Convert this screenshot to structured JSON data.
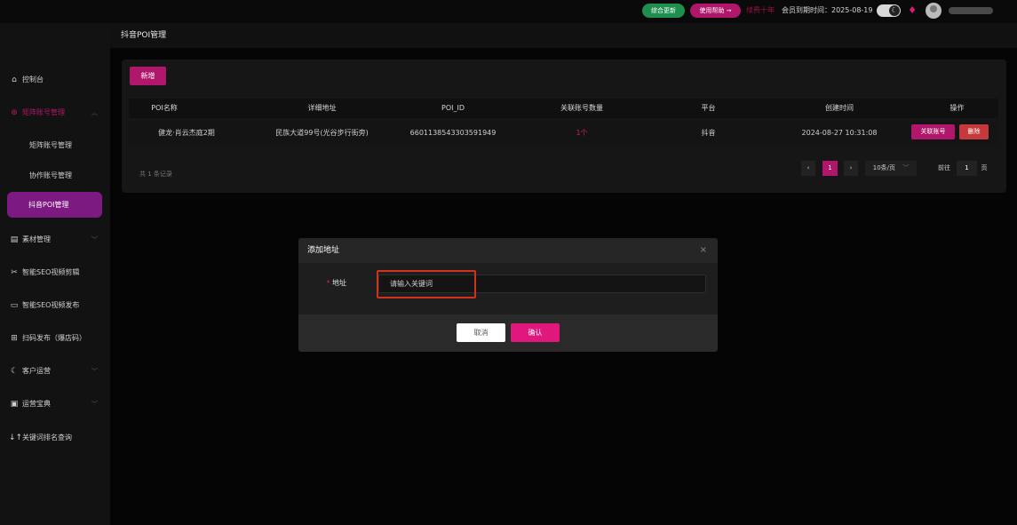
{
  "header": {
    "update_label": "综合更新",
    "help_label": "使用帮助 →",
    "renew_label": "续费十年",
    "expire_text": "会员到期时间：2025-08-19",
    "toggle_icon": "moon-icon",
    "bell_icon": "bell-icon"
  },
  "sidebar": {
    "items": [
      {
        "label": "控制台",
        "icon": "⌂"
      },
      {
        "label": "矩阵账号管理",
        "icon": "⊕"
      },
      {
        "label": "矩阵账号管理",
        "sub": true
      },
      {
        "label": "协作账号管理",
        "sub": true
      },
      {
        "label": "抖音POI管理",
        "sub": true
      },
      {
        "label": "素材管理",
        "icon": "▤"
      },
      {
        "label": "智能SEO视频剪辑",
        "icon": "✂"
      },
      {
        "label": "智能SEO视频发布",
        "icon": "▭"
      },
      {
        "label": "扫码发布（爆店码）",
        "icon": "⊞"
      },
      {
        "label": "客户运营",
        "icon": "☾"
      },
      {
        "label": "运营宝典",
        "icon": "▣"
      },
      {
        "label": "关键词排名查询",
        "icon": "ı"
      }
    ]
  },
  "main": {
    "page_title": "抖音POI管理",
    "add_button": "新增",
    "table": {
      "headers": [
        "POI名称",
        "详细地址",
        "POI_ID",
        "关联账号数量",
        "平台",
        "创建时间",
        "操作"
      ],
      "rows": [
        {
          "name": "健龙·肖云杰庭2期",
          "address": "民族大道99号(光谷步行街旁)",
          "poi_id": "6601138543303591949",
          "count": "1个",
          "platform": "抖音",
          "created": "2024-08-27 10:31:08",
          "link_btn": "关联账号",
          "delete_btn": "删除"
        }
      ]
    },
    "pagination": {
      "total": "共 1 条记录",
      "prev": "‹",
      "current": "1",
      "next": "›",
      "page_size": "10条/页",
      "goto_label": "前往",
      "goto_value": "1",
      "page_suffix": "页"
    }
  },
  "dialog": {
    "title": "添加地址",
    "close": "×",
    "required_mark": "*",
    "field_label": "地址",
    "placeholder": "请输入关键词",
    "cancel": "取消",
    "confirm": "确认"
  },
  "colors": {
    "accent": "#b0176a",
    "accent_bright": "#e0177d",
    "sidebar_active": "#7d1a82",
    "danger": "#c4393c",
    "success": "#1e8f4f"
  }
}
